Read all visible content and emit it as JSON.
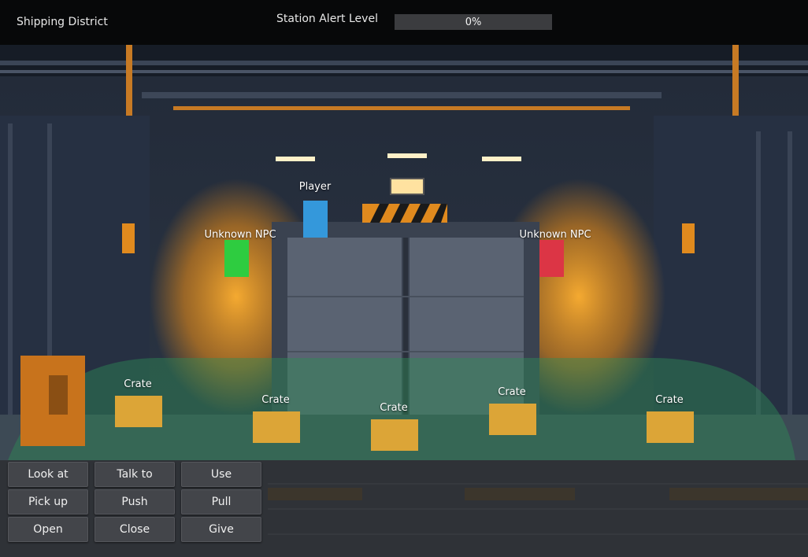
{
  "hud": {
    "location": "Shipping District",
    "alert_label": "Station Alert Level",
    "alert_value_text": "0%",
    "alert_level": 0
  },
  "scene": {
    "player_label": "Player",
    "npc_left_label": "Unknown NPC",
    "npc_right_label": "Unknown NPC",
    "crate_labels": [
      "Crate",
      "Crate",
      "Crate",
      "Crate",
      "Crate"
    ]
  },
  "colors": {
    "player": "#3498db",
    "npc_left": "#2ecc40",
    "npc_right": "#dc3545",
    "crate": "#dca537",
    "walkable_zone": "#2e8b57"
  },
  "verbs": [
    "Look at",
    "Talk to",
    "Use",
    "Pick up",
    "Push",
    "Pull",
    "Open",
    "Close",
    "Give"
  ]
}
